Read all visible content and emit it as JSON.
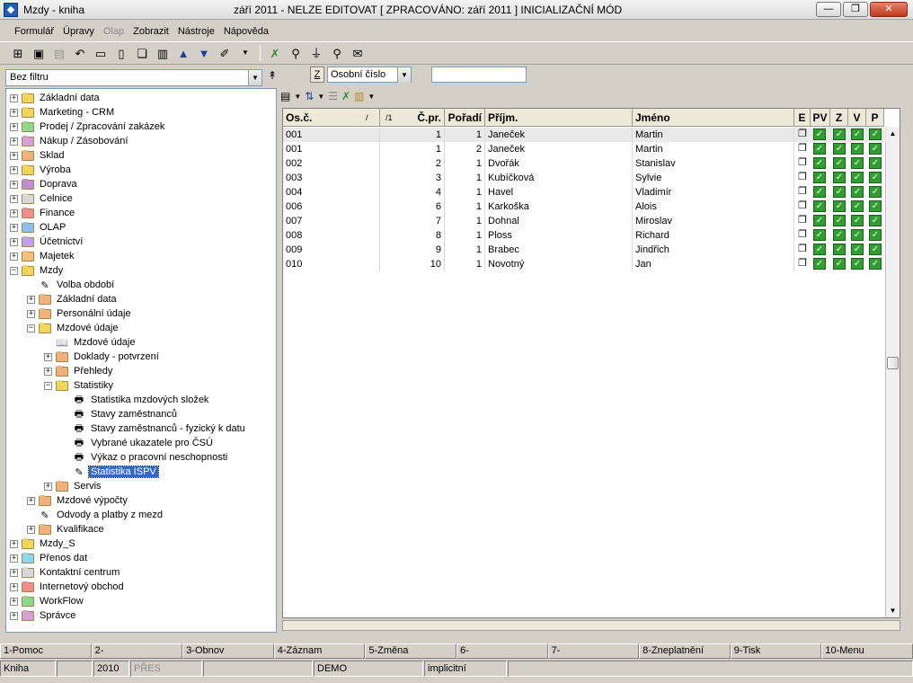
{
  "window": {
    "title": "Mzdy - kniha",
    "status_title": "září 2011 - NELZE EDITOVAT [ ZPRACOVÁNO: září 2011 ]  INICIALIZAČNÍ MÓD",
    "minimize": "—",
    "restore": "❐",
    "close": "✕"
  },
  "menu": {
    "items": [
      {
        "label": "Formulář",
        "enabled": true
      },
      {
        "label": "Úpravy",
        "enabled": true
      },
      {
        "label": "Olap",
        "enabled": false
      },
      {
        "label": "Zobrazit",
        "enabled": true
      },
      {
        "label": "Nástroje",
        "enabled": true
      },
      {
        "label": "Nápověda",
        "enabled": true
      }
    ]
  },
  "toolbar": {
    "icons": [
      "tree-icon",
      "save-icon",
      "save-as-icon",
      "undo-icon",
      "open-folder-icon",
      "new-document-icon",
      "copy-icon",
      "book-icon",
      "arrow-up-icon",
      "arrow-down-icon",
      "edit-record-icon",
      "dropdown-icon",
      "excel-export-icon",
      "find-icon",
      "filter-icon",
      "find-next-icon",
      "mail-icon"
    ]
  },
  "filter": {
    "value": "Bez filtru",
    "pin": "↟"
  },
  "tree": {
    "items": [
      {
        "label": "Základní data",
        "level": 0,
        "expander": "+",
        "color": "#f2d65c"
      },
      {
        "label": "Marketing - CRM",
        "level": 0,
        "expander": "+",
        "color": "#f2d65c"
      },
      {
        "label": "Prodej / Zpracování zakázek",
        "level": 0,
        "expander": "+",
        "color": "#8cd88c"
      },
      {
        "label": "Nákup / Zásobování",
        "level": 0,
        "expander": "+",
        "color": "#d6a0d6"
      },
      {
        "label": "Sklad",
        "level": 0,
        "expander": "+",
        "color": "#f2b07a"
      },
      {
        "label": "Výroba",
        "level": 0,
        "expander": "+",
        "color": "#f2d65c"
      },
      {
        "label": "Doprava",
        "level": 0,
        "expander": "+",
        "color": "#c08cd8"
      },
      {
        "label": "Celnice",
        "level": 0,
        "expander": "+",
        "color": "#d8d8d8"
      },
      {
        "label": "Finance",
        "level": 0,
        "expander": "+",
        "color": "#f28c8c"
      },
      {
        "label": "OLAP",
        "level": 0,
        "expander": "+",
        "color": "#8cc0f2"
      },
      {
        "label": "Účetnictví",
        "level": 0,
        "expander": "+",
        "color": "#c0a0f2"
      },
      {
        "label": "Majetek",
        "level": 0,
        "expander": "+",
        "color": "#f2c07a"
      },
      {
        "label": "Mzdy",
        "level": 0,
        "expander": "−",
        "color": "#f2d65c"
      },
      {
        "label": "Volba období",
        "level": 1,
        "expander": "",
        "icon": "✎"
      },
      {
        "label": "Základní data",
        "level": 1,
        "expander": "+",
        "color": "#f2b07a"
      },
      {
        "label": "Personální údaje",
        "level": 1,
        "expander": "+",
        "color": "#f2b07a"
      },
      {
        "label": "Mzdové údaje",
        "level": 1,
        "expander": "−",
        "color": "#f2d65c"
      },
      {
        "label": "Mzdové údaje",
        "level": 2,
        "expander": "",
        "icon": "📖"
      },
      {
        "label": "Doklady - potvrzení",
        "level": 2,
        "expander": "+",
        "color": "#f2b07a"
      },
      {
        "label": "Přehledy",
        "level": 2,
        "expander": "+",
        "color": "#f2b07a"
      },
      {
        "label": "Statistiky",
        "level": 2,
        "expander": "−",
        "color": "#f2d65c"
      },
      {
        "label": "Statistika mzdových složek",
        "level": 3,
        "expander": "",
        "icon": "🖶"
      },
      {
        "label": "Stavy zaměstnanců",
        "level": 3,
        "expander": "",
        "icon": "🖶"
      },
      {
        "label": "Stavy zaměstnanců - fyzický k datu",
        "level": 3,
        "expander": "",
        "icon": "🖶"
      },
      {
        "label": "Vybrané ukazatele pro ČSÚ",
        "level": 3,
        "expander": "",
        "icon": "🖶"
      },
      {
        "label": "Výkaz o pracovní neschopnosti",
        "level": 3,
        "expander": "",
        "icon": "🖶"
      },
      {
        "label": "Statistika ISPV",
        "level": 3,
        "expander": "",
        "icon": "✎",
        "selected": true
      },
      {
        "label": "Servis",
        "level": 2,
        "expander": "+",
        "color": "#f2b07a"
      },
      {
        "label": "Mzdové výpočty",
        "level": 1,
        "expander": "+",
        "color": "#f2b07a"
      },
      {
        "label": "Odvody a platby z mezd",
        "level": 1,
        "expander": "",
        "icon": "✎"
      },
      {
        "label": "Kvalifikace",
        "level": 1,
        "expander": "+",
        "color": "#f2b07a"
      },
      {
        "label": "Mzdy_S",
        "level": 0,
        "expander": "+",
        "color": "#f2d65c"
      },
      {
        "label": "Přenos dat",
        "level": 0,
        "expander": "+",
        "color": "#8cd8f2"
      },
      {
        "label": "Kontaktní centrum",
        "level": 0,
        "expander": "+",
        "color": "#d8d8d8"
      },
      {
        "label": "Internetový obchod",
        "level": 0,
        "expander": "+",
        "color": "#f28c8c"
      },
      {
        "label": "WorkFlow",
        "level": 0,
        "expander": "+",
        "color": "#8cd88c"
      },
      {
        "label": "Správce",
        "level": 0,
        "expander": "+",
        "color": "#d6a0d6"
      }
    ]
  },
  "sort": {
    "button": "Z",
    "field": "Osobní číslo",
    "search_value": ""
  },
  "grid": {
    "columns": [
      {
        "label": "Os.č."
      },
      {
        "label": "Č.pr."
      },
      {
        "label": "Pořadí"
      },
      {
        "label": "Příjm."
      },
      {
        "label": "Jméno"
      },
      {
        "label": "E"
      },
      {
        "label": "PV"
      },
      {
        "label": "Z"
      },
      {
        "label": "V"
      },
      {
        "label": "P"
      }
    ],
    "sort_marks": [
      "/",
      "/1"
    ],
    "rows": [
      {
        "os": "001",
        "cpr": "1",
        "por": "1",
        "prijm": "Janeček",
        "jmeno": "Martin"
      },
      {
        "os": "001",
        "cpr": "1",
        "por": "2",
        "prijm": "Janeček",
        "jmeno": "Martin"
      },
      {
        "os": "002",
        "cpr": "2",
        "por": "1",
        "prijm": "Dvořák",
        "jmeno": "Stanislav"
      },
      {
        "os": "003",
        "cpr": "3",
        "por": "1",
        "prijm": "Kubíčková",
        "jmeno": "Sylvie"
      },
      {
        "os": "004",
        "cpr": "4",
        "por": "1",
        "prijm": "Havel",
        "jmeno": "Vladimír"
      },
      {
        "os": "006",
        "cpr": "6",
        "por": "1",
        "prijm": "Karkoška",
        "jmeno": "Alois"
      },
      {
        "os": "007",
        "cpr": "7",
        "por": "1",
        "prijm": "Dohnal",
        "jmeno": "Miroslav"
      },
      {
        "os": "008",
        "cpr": "8",
        "por": "1",
        "prijm": "Ploss",
        "jmeno": "Richard"
      },
      {
        "os": "009",
        "cpr": "9",
        "por": "1",
        "prijm": "Brabec",
        "jmeno": "Jindřich"
      },
      {
        "os": "010",
        "cpr": "10",
        "por": "1",
        "prijm": "Novotný",
        "jmeno": "Jan"
      }
    ]
  },
  "fkeys": [
    "1-Pomoc",
    "2-",
    "3-Obnov",
    "4-Záznam",
    "5-Změna",
    "6-",
    "7-",
    "8-Zneplatnění",
    "9-Tisk",
    "10-Menu"
  ],
  "status": {
    "module": "Kniha",
    "year": "2010",
    "mode": "PŘES",
    "db": "DEMO",
    "profile": "implicitní"
  },
  "colors": {
    "selection": "#3169c6",
    "check": "#2f9f2f"
  }
}
